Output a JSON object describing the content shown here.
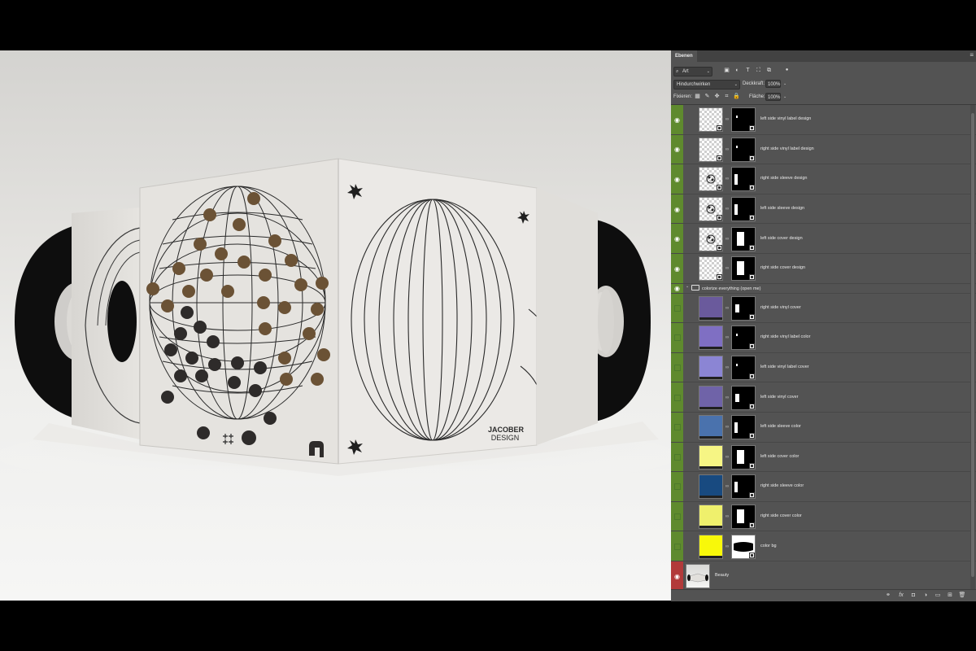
{
  "canvas": {
    "brand_lines": [
      "JACOBER",
      "DESIGN"
    ],
    "brand_logo_text": "m"
  },
  "panel": {
    "tab": "Ebenen",
    "filter": {
      "kind": "Art"
    },
    "blend_mode": "Hindurchwirken",
    "opacity_label": "Deckkraft:",
    "opacity_value": "100%",
    "lock_label": "Fixieren:",
    "fill_label": "Fläche:",
    "fill_value": "100%",
    "colors": {
      "visible_active": "#5f8a2e",
      "hidden_marker": "#5f8a2e",
      "selected": "#b23a3a"
    }
  },
  "layers": [
    {
      "name": "left side vinyl label design",
      "visible": true,
      "thumb": "checker",
      "smart": true,
      "mask": "dot"
    },
    {
      "name": "right side vinyl label design",
      "visible": true,
      "thumb": "checker",
      "smart": true,
      "mask": "dot"
    },
    {
      "name": "right side sleeve design",
      "visible": true,
      "thumb": "checker-art",
      "smart": true,
      "mask": "bar"
    },
    {
      "name": "left side sleeve design",
      "visible": true,
      "thumb": "checker-art",
      "smart": true,
      "mask": "bar"
    },
    {
      "name": "left side cover design",
      "visible": true,
      "thumb": "checker-art",
      "smart": true,
      "mask": "trap"
    },
    {
      "name": "right side cover design",
      "visible": true,
      "thumb": "checker",
      "smart": true,
      "mask": "trap"
    },
    {
      "name": "colorize everything (open me)",
      "group": true,
      "visible": true
    },
    {
      "name": "right side vinyl cover",
      "visible": false,
      "color": "#6a5a9c",
      "mask": "half"
    },
    {
      "name": "right side vinyl label color",
      "visible": false,
      "color": "#7f6fc3",
      "mask": "dot"
    },
    {
      "name": "left side vinyl label cover",
      "visible": false,
      "color": "#8b85d4",
      "mask": "dot"
    },
    {
      "name": "left side vinyl cover",
      "visible": false,
      "color": "#6f63a8",
      "mask": "half"
    },
    {
      "name": "left side sleeve color",
      "visible": false,
      "color": "#4a72ad",
      "mask": "bar"
    },
    {
      "name": "left side cover color",
      "visible": false,
      "color": "#f6f584",
      "mask": "trap"
    },
    {
      "name": "right side sleeve color",
      "visible": false,
      "color": "#184a80",
      "mask": "bar"
    },
    {
      "name": "right side cover color",
      "visible": false,
      "color": "#eff06c",
      "mask": "trap"
    },
    {
      "name": "color bg",
      "visible": false,
      "color": "#f8f80a",
      "mask": "blob"
    },
    {
      "name": "Beauty",
      "visible": true,
      "selected": true,
      "thumb": "photo"
    }
  ]
}
